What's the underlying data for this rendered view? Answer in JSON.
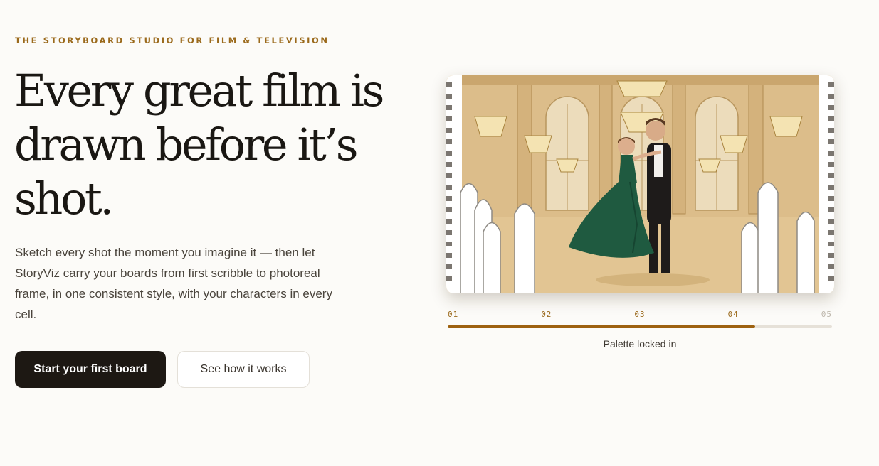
{
  "hero": {
    "eyebrow": "THE STORYBOARD STUDIO FOR FILM & TELEVISION",
    "headline": [
      "Every great film is",
      "drawn before it’s",
      "shot."
    ],
    "lede": "Sketch every shot the moment you imagine it — then let StoryViz carry your boards from first scribble to photoreal frame, in one consistent style, with your characters in every cell.",
    "primary_cta": "Start your first board",
    "secondary_cta": "See how it works"
  },
  "preview": {
    "image_desc": "ballroom-dance-storyboard-frame",
    "steps": [
      "01",
      "02",
      "03",
      "04",
      "05"
    ],
    "current_step": 4,
    "progress": 0.8,
    "caption": "Palette locked in"
  },
  "colors": {
    "accent": "#9b6a1c",
    "progress": "#9e6210",
    "button_dark": "#1d1813",
    "background": "#fcfbf8",
    "gown": "#1f5a40"
  }
}
